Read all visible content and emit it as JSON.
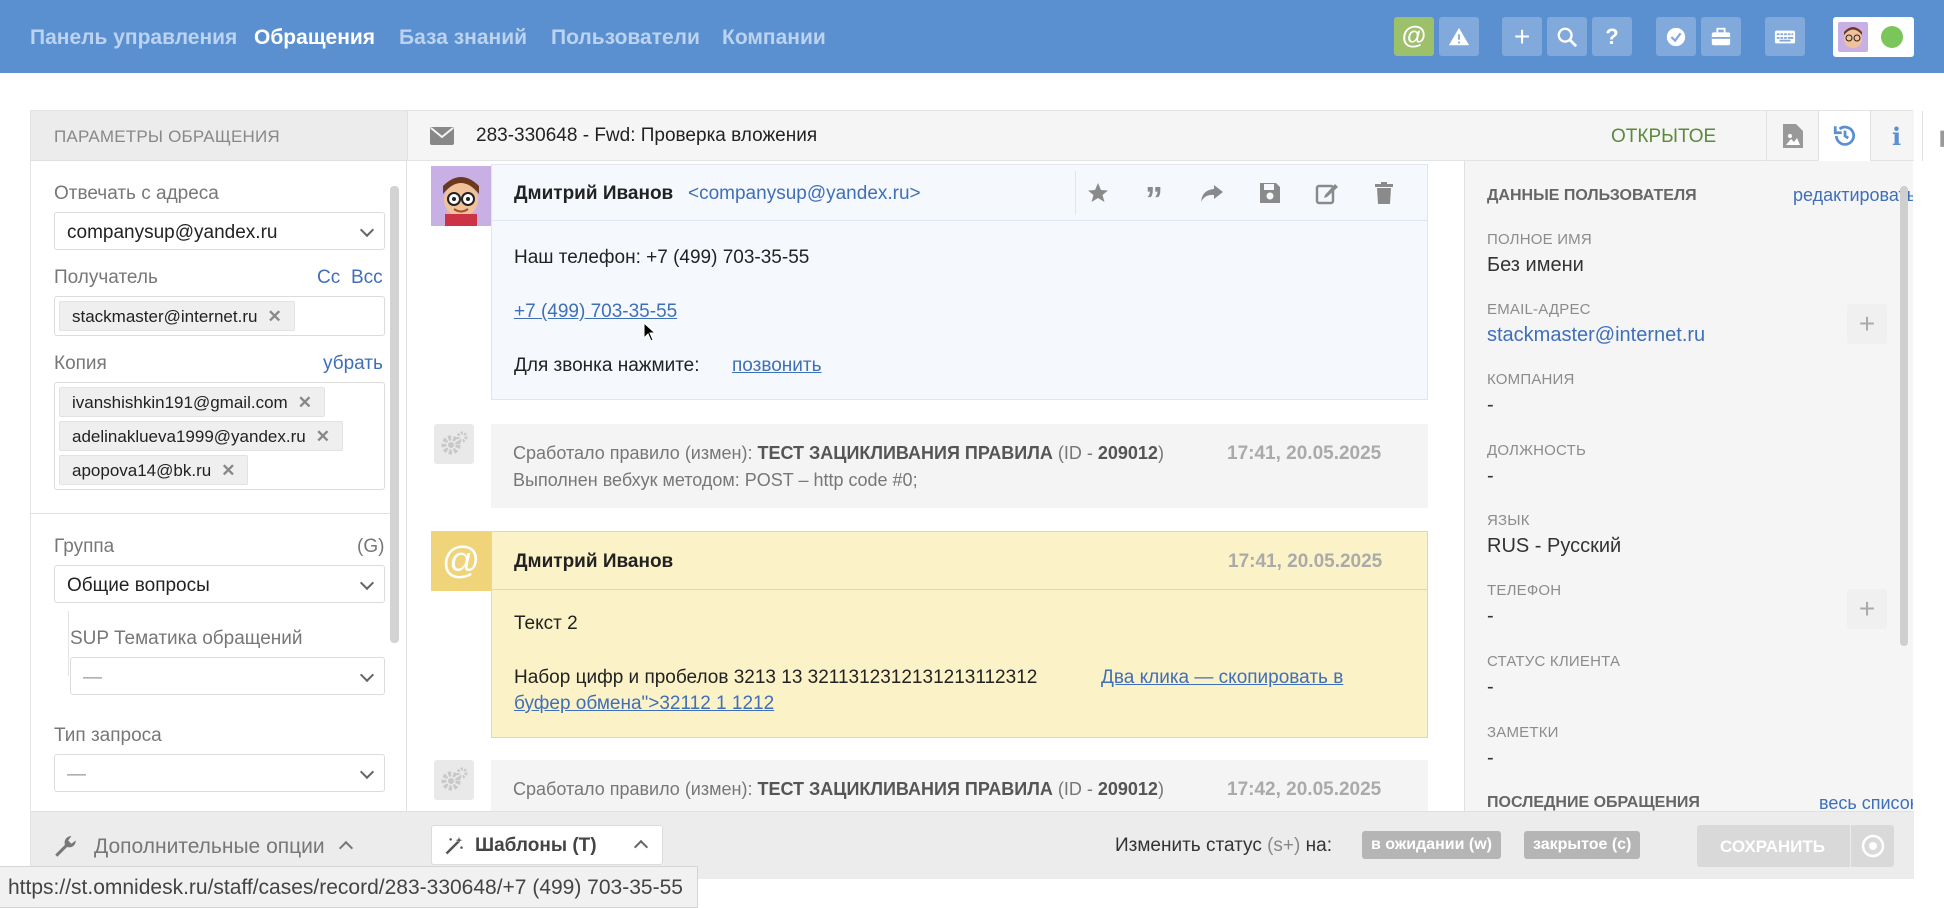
{
  "nav": {
    "items": [
      "Панель управления",
      "Обращения",
      "База знаний",
      "Пользователи",
      "Компании"
    ]
  },
  "toolbar": {
    "help": "?"
  },
  "left": {
    "header": "ПАРАМЕТРЫ ОБРАЩЕНИЯ",
    "reply_label": "Отвечать с адреса",
    "reply_value": "companysup@yandex.ru",
    "recipient_label": "Получатель",
    "cc": "Cc",
    "bcc": "Bcc",
    "recipient": "stackmaster@internet.ru",
    "copy_label": "Копия",
    "remove": "убрать",
    "copies": [
      "ivanshishkin191@gmail.com",
      "adelinaklueva1999@yandex.ru",
      "apopova14@bk.ru"
    ],
    "group_label": "Группа",
    "group_hotkey": "(G)",
    "group_value": "Общие вопросы",
    "topic_label": "SUP Тематика обращений",
    "topic_value": "—",
    "type_label": "Тип запроса",
    "type_value": "—",
    "more_options": "Дополнительные опции"
  },
  "case": {
    "title": "283-330648 - Fwd: Проверка вложения",
    "status": "ОТКРЫТОЕ"
  },
  "msg1": {
    "sender": "Дмитрий Иванов",
    "email": "<companysup@yandex.ru>",
    "line1": "Наш телефон: +7 (499) 703-35-55",
    "phone_link": "+7 (499) 703-35-55",
    "call_text": "Для звонка нажмите:",
    "call_link": "позвонить"
  },
  "sys1": {
    "prefix": "Сработало правило (измен):",
    "rule": "ТЕСТ ЗАЦИКЛИВАНИЯ ПРАВИЛА",
    "id_open": "(ID -",
    "id": "209012",
    "id_close": ")",
    "time": "17:41, 20.05.2025",
    "line2": "Выполнен вебхук методом: POST – http code #0;"
  },
  "msg2": {
    "sender": "Дмитрий Иванов",
    "time": "17:41, 20.05.2025",
    "line1": "Текст 2",
    "line2": "Набор цифр и пробелов 3213 13 3211312312131213112312",
    "link1": "Два клика — скопировать в",
    "link2": "буфер обмена\">32112 1 1212"
  },
  "sys2": {
    "prefix": "Сработало правило (измен):",
    "rule": "ТЕСТ ЗАЦИКЛИВАНИЯ ПРАВИЛА",
    "id_open": "(ID -",
    "id": "209012",
    "id_close": ")",
    "time": "17:42, 20.05.2025"
  },
  "right": {
    "header": "ДАННЫЕ ПОЛЬЗОВАТЕЛЯ",
    "edit": "редактировать",
    "name_label": "ПОЛНОЕ ИМЯ",
    "name": "Без имени",
    "email_label": "EMAIL-АДРЕС",
    "email": "stackmaster@internet.ru",
    "company_label": "КОМПАНИЯ",
    "company": "-",
    "position_label": "ДОЛЖНОСТЬ",
    "position": "-",
    "lang_label": "ЯЗЫК",
    "lang": "RUS - Русский",
    "phone_label": "ТЕЛЕФОН",
    "phone": "-",
    "client_status_label": "СТАТУС КЛИЕНТА",
    "client_status": "-",
    "notes_label": "ЗАМЕТКИ",
    "notes": "-",
    "last_label": "ПОСЛЕДНИЕ ОБРАЩЕНИЯ",
    "all_list": "весь список"
  },
  "bottom": {
    "templates": "Шаблоны (T)",
    "change_status": "Изменить статус",
    "status_hotkey": "(s+)",
    "on": "на:",
    "pending": "в ожидании (w)",
    "closed": "закрытое (c)",
    "save": "СОХРАНИТЬ"
  },
  "statusbar": {
    "url": "https://st.omnidesk.ru/staff/cases/record/283-330648/+7 (499) 703-35-55"
  }
}
